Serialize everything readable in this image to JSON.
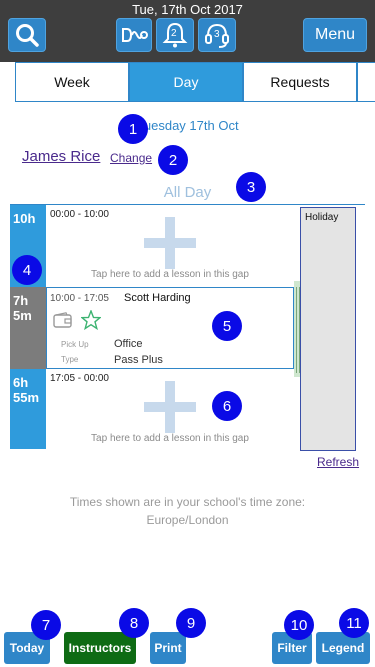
{
  "header": {
    "date": "Tue, 17th Oct 2017",
    "menu_label": "Menu",
    "notifications_count": "2",
    "support_count": "3"
  },
  "tabs": [
    {
      "label": "Week"
    },
    {
      "label": "Day"
    },
    {
      "label": "Requests"
    }
  ],
  "day": {
    "date_label": "Tuesday 17th Oct",
    "instructor_name": "James Rice",
    "change_label": "Change",
    "all_day_label": "All Day"
  },
  "schedule": {
    "gap1": {
      "duration": "10h",
      "time": "00:00 - 10:00",
      "tap_text": "Tap here to add a lesson in this gap"
    },
    "lesson": {
      "duration_h": "7h",
      "duration_m": "5m",
      "time": "10:00 - 17:05",
      "student": "Scott  Harding",
      "pickup_label": "Pick Up",
      "type_label": "Type",
      "pickup_value": "Office",
      "type_value": "Pass Plus"
    },
    "gap2": {
      "duration_h": "6h",
      "duration_m": "55m",
      "time": "17:05 - 00:00",
      "tap_text": "Tap here to add a lesson in this gap"
    },
    "holiday_label": "Holiday"
  },
  "refresh_label": "Refresh",
  "timezone_text": {
    "line1": "Times shown are in your school's time zone:",
    "line2": "Europe/London"
  },
  "bottom": {
    "today": "Today",
    "instructors": "Instructors",
    "print": "Print",
    "filter": "Filter",
    "legend": "Legend"
  },
  "markers": [
    "1",
    "2",
    "3",
    "4",
    "5",
    "6",
    "7",
    "8",
    "9",
    "10",
    "11"
  ],
  "colors": {
    "topbar": "#3e3e3e",
    "primary": "#2f86c8",
    "active_tab": "#2f9bdc",
    "marker": "#0a0ae6",
    "instructors_btn": "#0e6b14",
    "lesson_bar": "#7c7c7c",
    "gap_bar": "#2f9bdc"
  }
}
